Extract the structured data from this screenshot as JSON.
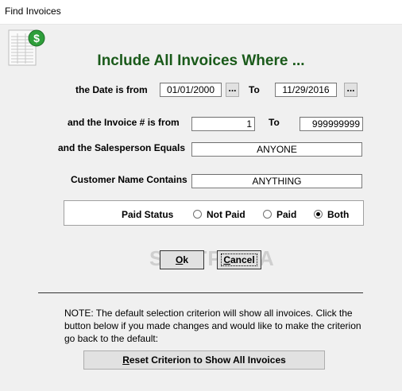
{
  "window": {
    "title": "Find Invoices"
  },
  "heading": "Include All Invoices Where ...",
  "date": {
    "label": "the Date is from",
    "from_value": "01/01/2000",
    "to_label": "To",
    "to_value": "11/29/2016",
    "picker_label": "..."
  },
  "invoice": {
    "label": "and the Invoice # is from",
    "from_value": "1",
    "to_label": "To",
    "to_value": "999999999"
  },
  "salesperson": {
    "label": "and the Salesperson Equals",
    "value": "ANYONE"
  },
  "customer": {
    "label": "Customer Name Contains",
    "value": "ANYTHING"
  },
  "paid_status": {
    "label": "Paid Status",
    "options": [
      "Not Paid",
      "Paid",
      "Both"
    ],
    "selected": "Both"
  },
  "buttons": {
    "ok_key": "O",
    "ok_rest": "k",
    "cancel_key": "C",
    "cancel_rest": "ancel"
  },
  "watermark": "SOFTPEDIA",
  "note": "NOTE: The default selection criterion will show all invoices.  Click the button below if you made changes and would like to make the criterion go back to the default:",
  "reset": {
    "key": "R",
    "rest": "eset Criterion to Show All Invoices"
  },
  "colors": {
    "heading": "#1a5a1a",
    "background": "#f0f0f0",
    "dollar_badge": "#2e9e3a"
  }
}
